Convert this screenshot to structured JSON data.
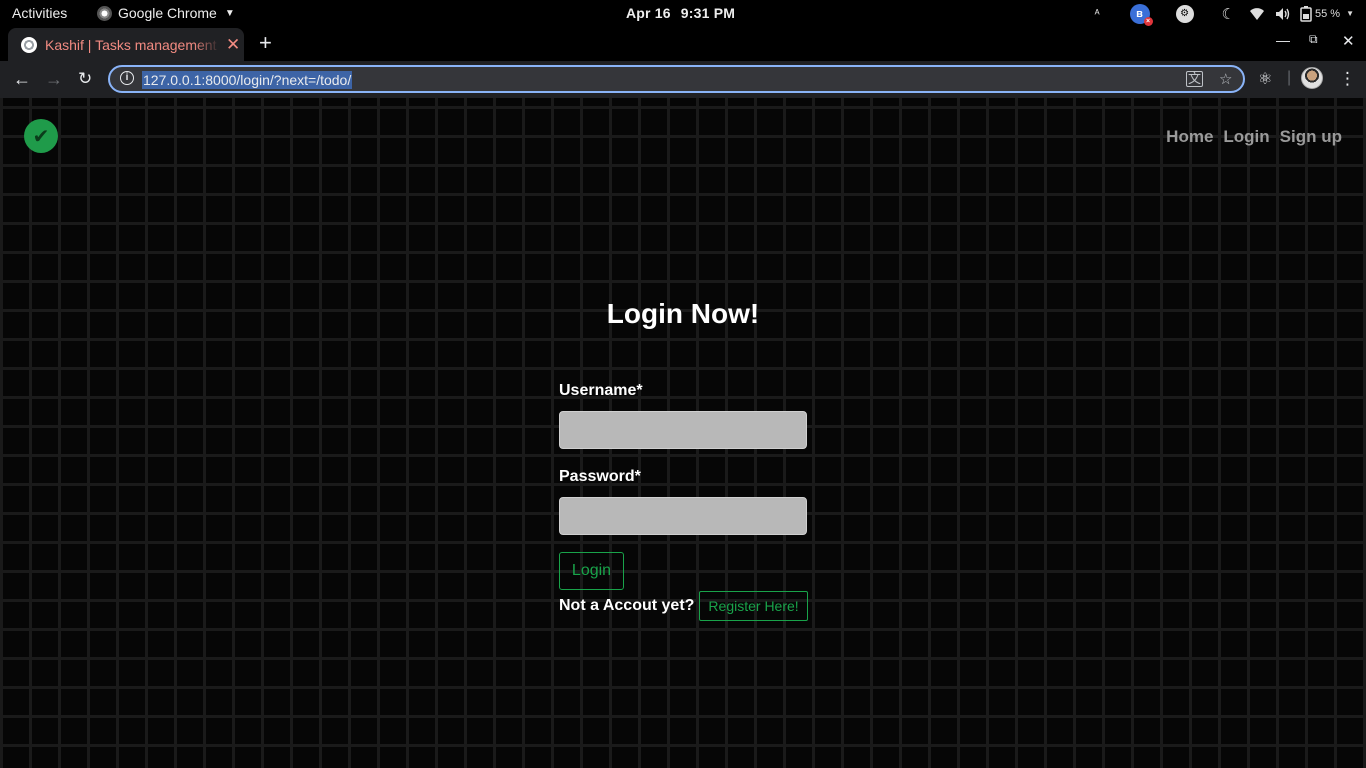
{
  "system_bar": {
    "activities": "Activities",
    "app_name": "Google Chrome",
    "date": "Apr 16",
    "time": "9:31 PM",
    "battery": "55 %"
  },
  "browser": {
    "tab_title": "Kashif | Tasks management",
    "url": "127.0.0.1:8000/login/?next=/todo/"
  },
  "site": {
    "nav": {
      "home": "Home",
      "login": "Login",
      "signup": "Sign up"
    },
    "heading": "Login Now!",
    "username_label": "Username*",
    "password_label": "Password*",
    "login_button": "Login",
    "register_prompt": "Not a Accout yet?",
    "register_button": "Register Here!"
  },
  "colors": {
    "accent_green": "#19a34a",
    "tab_text": "#f28b82"
  }
}
